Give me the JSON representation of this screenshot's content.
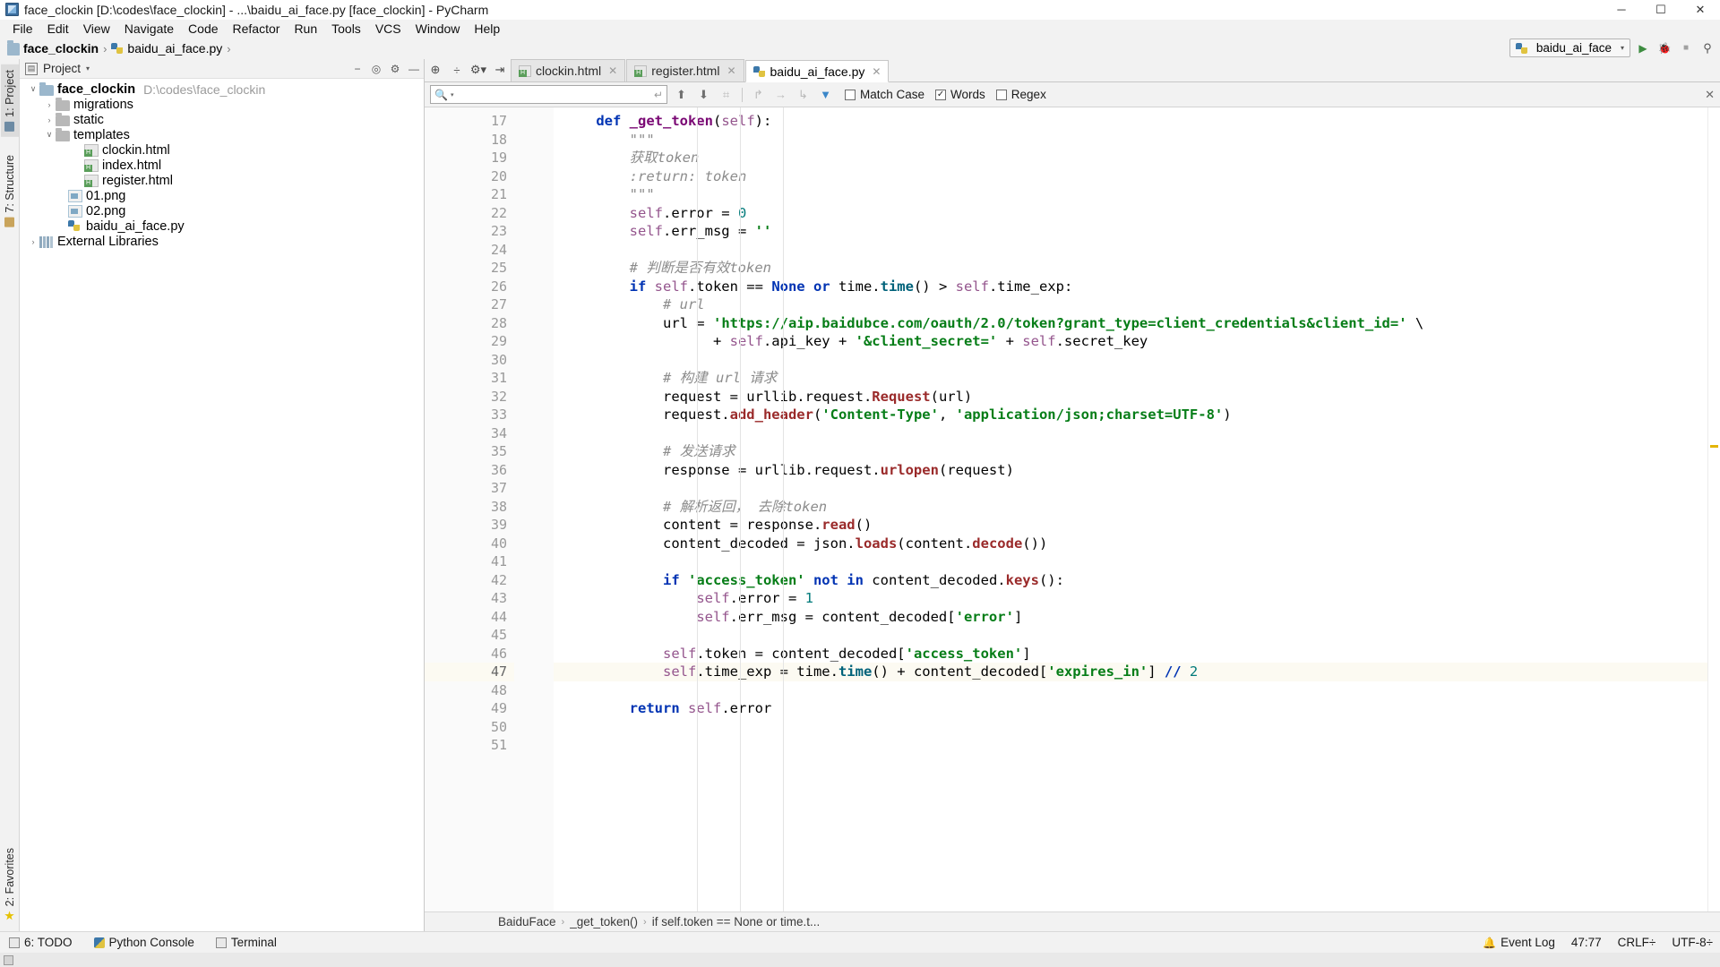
{
  "window": {
    "title": "face_clockin [D:\\codes\\face_clockin] - ...\\baidu_ai_face.py [face_clockin] - PyCharm",
    "minimize": "─",
    "maximize": "☐",
    "close": "✕"
  },
  "menu": {
    "items": [
      "File",
      "Edit",
      "View",
      "Navigate",
      "Code",
      "Refactor",
      "Run",
      "Tools",
      "VCS",
      "Window",
      "Help"
    ]
  },
  "breadcrumb": {
    "items": [
      "face_clockin",
      "baidu_ai_face.py"
    ],
    "separator": "›"
  },
  "toolbar_right": {
    "run_config": "baidu_ai_face",
    "caret": "▾",
    "run": "▶",
    "debug": "🐞",
    "stop": "■",
    "search_everywhere": "⚲"
  },
  "left_strip": {
    "tabs": [
      "1: Project",
      "7: Structure"
    ],
    "bottom_tabs": [
      "2: Favorites"
    ]
  },
  "project_panel": {
    "title": "Project",
    "caret": "▾",
    "header_icons": [
      "collapse-all-icon",
      "target-icon",
      "gear-icon",
      "hide-icon"
    ],
    "tree": [
      {
        "indent": 0,
        "arrow": "∨",
        "icon": "folder-module",
        "label": "face_clockin",
        "bold": true,
        "path": "D:\\codes\\face_clockin"
      },
      {
        "indent": 1,
        "arrow": "›",
        "icon": "folder",
        "label": "migrations",
        "bold": false,
        "path": ""
      },
      {
        "indent": 1,
        "arrow": "›",
        "icon": "folder",
        "label": "static",
        "bold": false,
        "path": ""
      },
      {
        "indent": 1,
        "arrow": "∨",
        "icon": "folder",
        "label": "templates",
        "bold": false,
        "path": ""
      },
      {
        "indent": 2,
        "arrow": "",
        "icon": "html",
        "label": "clockin.html",
        "bold": false,
        "path": ""
      },
      {
        "indent": 2,
        "arrow": "",
        "icon": "html",
        "label": "index.html",
        "bold": false,
        "path": ""
      },
      {
        "indent": 2,
        "arrow": "",
        "icon": "html",
        "label": "register.html",
        "bold": false,
        "path": ""
      },
      {
        "indent": 1,
        "arrow": "",
        "icon": "png",
        "label": "01.png",
        "bold": false,
        "path": ""
      },
      {
        "indent": 1,
        "arrow": "",
        "icon": "png",
        "label": "02.png",
        "bold": false,
        "path": ""
      },
      {
        "indent": 1,
        "arrow": "",
        "icon": "py",
        "label": "baidu_ai_face.py",
        "bold": false,
        "path": ""
      },
      {
        "indent": 0,
        "arrow": "›",
        "icon": "lib",
        "label": "External Libraries",
        "bold": false,
        "path": ""
      }
    ]
  },
  "editor": {
    "tab_tools": [
      "⊕",
      "÷",
      "⚙▾",
      "⇥"
    ],
    "tabs": [
      {
        "label": "clockin.html",
        "icon": "html-file-icon",
        "active": false,
        "close": "✕"
      },
      {
        "label": "register.html",
        "icon": "html-file-icon",
        "active": false,
        "close": "✕"
      },
      {
        "label": "baidu_ai_face.py",
        "icon": "python-file-icon",
        "active": true,
        "close": "✕"
      }
    ],
    "find_bar": {
      "search_value": "",
      "search_placeholder": "",
      "search_icon": "🔍",
      "dropdown_caret": "▾",
      "enter_hint": "↵",
      "buttons": [
        "⬆",
        "⬇",
        "⌗",
        "↱",
        "→",
        "↳",
        "filter-icon"
      ],
      "checkboxes": [
        {
          "label": "Match Case",
          "checked": false
        },
        {
          "label": "Words",
          "checked": true
        },
        {
          "label": "Regex",
          "checked": false
        }
      ],
      "close": "✕"
    },
    "first_line_number": 17,
    "current_line": 47,
    "lines": [
      {
        "n": 17,
        "fold": "−",
        "bulb": false,
        "tokens": [
          {
            "t": "    ",
            "c": "pl"
          },
          {
            "t": "def ",
            "c": "kw"
          },
          {
            "t": "_get_token",
            "c": "fnd"
          },
          {
            "t": "(",
            "c": "brk"
          },
          {
            "t": "self",
            "c": "selfk"
          },
          {
            "t": "):",
            "c": "brk"
          }
        ]
      },
      {
        "n": 18,
        "fold": "−",
        "bulb": false,
        "tokens": [
          {
            "t": "        \"\"\"",
            "c": "doc"
          }
        ]
      },
      {
        "n": 19,
        "fold": "",
        "bulb": false,
        "tokens": [
          {
            "t": "        获取token",
            "c": "doc"
          }
        ]
      },
      {
        "n": 20,
        "fold": "",
        "bulb": false,
        "tokens": [
          {
            "t": "        :return: token",
            "c": "doc"
          }
        ]
      },
      {
        "n": 21,
        "fold": "−",
        "bulb": false,
        "tokens": [
          {
            "t": "        \"\"\"",
            "c": "doc"
          }
        ]
      },
      {
        "n": 22,
        "fold": "",
        "bulb": false,
        "tokens": [
          {
            "t": "        ",
            "c": "pl"
          },
          {
            "t": "self",
            "c": "selfk"
          },
          {
            "t": ".error = ",
            "c": "pl"
          },
          {
            "t": "0",
            "c": "teal"
          }
        ]
      },
      {
        "n": 23,
        "fold": "",
        "bulb": false,
        "tokens": [
          {
            "t": "        ",
            "c": "pl"
          },
          {
            "t": "self",
            "c": "selfk"
          },
          {
            "t": ".err_msg = ",
            "c": "pl"
          },
          {
            "t": "''",
            "c": "str"
          }
        ]
      },
      {
        "n": 24,
        "fold": "",
        "bulb": false,
        "tokens": []
      },
      {
        "n": 25,
        "fold": "",
        "bulb": false,
        "tokens": [
          {
            "t": "        # 判断是否有效token",
            "c": "cmt"
          }
        ]
      },
      {
        "n": 26,
        "fold": "−",
        "bulb": false,
        "tokens": [
          {
            "t": "        ",
            "c": "pl"
          },
          {
            "t": "if ",
            "c": "kw"
          },
          {
            "t": "self",
            "c": "selfk"
          },
          {
            "t": ".token == ",
            "c": "pl"
          },
          {
            "t": "None",
            "c": "kw"
          },
          {
            "t": " or ",
            "c": "kw"
          },
          {
            "t": "time.",
            "c": "pl"
          },
          {
            "t": "time",
            "c": "fn"
          },
          {
            "t": "() > ",
            "c": "pl"
          },
          {
            "t": "self",
            "c": "selfk"
          },
          {
            "t": ".time_exp:",
            "c": "pl"
          }
        ]
      },
      {
        "n": 27,
        "fold": "",
        "bulb": false,
        "tokens": [
          {
            "t": "            # url",
            "c": "cmt"
          }
        ]
      },
      {
        "n": 28,
        "fold": "",
        "bulb": false,
        "tokens": [
          {
            "t": "            url = ",
            "c": "pl"
          },
          {
            "t": "'https://aip.baidubce.com/oauth/2.0/token?grant_type=client_credentials&client_id='",
            "c": "str"
          },
          {
            "t": " \\",
            "c": "pl"
          }
        ]
      },
      {
        "n": 29,
        "fold": "",
        "bulb": false,
        "tokens": [
          {
            "t": "                  + ",
            "c": "pl"
          },
          {
            "t": "self",
            "c": "selfk"
          },
          {
            "t": ".api_key + ",
            "c": "pl"
          },
          {
            "t": "'&client_secret='",
            "c": "str"
          },
          {
            "t": " + ",
            "c": "pl"
          },
          {
            "t": "self",
            "c": "selfk"
          },
          {
            "t": ".secret_key",
            "c": "pl"
          }
        ]
      },
      {
        "n": 30,
        "fold": "",
        "bulb": false,
        "tokens": []
      },
      {
        "n": 31,
        "fold": "",
        "bulb": false,
        "tokens": [
          {
            "t": "            # 构建 url 请求",
            "c": "cmt"
          }
        ]
      },
      {
        "n": 32,
        "fold": "",
        "bulb": false,
        "tokens": [
          {
            "t": "            request = urllib.request.",
            "c": "pl"
          },
          {
            "t": "Request",
            "c": "red"
          },
          {
            "t": "(url)",
            "c": "pl"
          }
        ]
      },
      {
        "n": 33,
        "fold": "",
        "bulb": false,
        "tokens": [
          {
            "t": "            request.",
            "c": "pl"
          },
          {
            "t": "add_header",
            "c": "red"
          },
          {
            "t": "(",
            "c": "pl"
          },
          {
            "t": "'Content-Type'",
            "c": "str"
          },
          {
            "t": ", ",
            "c": "pl"
          },
          {
            "t": "'application/json;charset=UTF-8'",
            "c": "str"
          },
          {
            "t": ")",
            "c": "pl"
          }
        ]
      },
      {
        "n": 34,
        "fold": "",
        "bulb": false,
        "tokens": []
      },
      {
        "n": 35,
        "fold": "",
        "bulb": false,
        "tokens": [
          {
            "t": "            # 发送请求",
            "c": "cmt"
          }
        ]
      },
      {
        "n": 36,
        "fold": "",
        "bulb": false,
        "tokens": [
          {
            "t": "            response = urllib.request.",
            "c": "pl"
          },
          {
            "t": "urlopen",
            "c": "red"
          },
          {
            "t": "(request)",
            "c": "pl"
          }
        ]
      },
      {
        "n": 37,
        "fold": "",
        "bulb": false,
        "tokens": []
      },
      {
        "n": 38,
        "fold": "",
        "bulb": false,
        "tokens": [
          {
            "t": "            # 解析返回， 去除token",
            "c": "cmt"
          }
        ]
      },
      {
        "n": 39,
        "fold": "",
        "bulb": false,
        "tokens": [
          {
            "t": "            content = response.",
            "c": "pl"
          },
          {
            "t": "read",
            "c": "red"
          },
          {
            "t": "()",
            "c": "pl"
          }
        ]
      },
      {
        "n": 40,
        "fold": "",
        "bulb": false,
        "tokens": [
          {
            "t": "            content_decoded = json.",
            "c": "pl"
          },
          {
            "t": "loads",
            "c": "red"
          },
          {
            "t": "(content.",
            "c": "pl"
          },
          {
            "t": "decode",
            "c": "red"
          },
          {
            "t": "())",
            "c": "pl"
          }
        ]
      },
      {
        "n": 41,
        "fold": "",
        "bulb": false,
        "tokens": []
      },
      {
        "n": 42,
        "fold": "−",
        "bulb": false,
        "tokens": [
          {
            "t": "            ",
            "c": "pl"
          },
          {
            "t": "if ",
            "c": "kw"
          },
          {
            "t": "'access_token'",
            "c": "str"
          },
          {
            "t": " not in ",
            "c": "kw"
          },
          {
            "t": "content_decoded.",
            "c": "pl"
          },
          {
            "t": "keys",
            "c": "red"
          },
          {
            "t": "():",
            "c": "pl"
          }
        ]
      },
      {
        "n": 43,
        "fold": "",
        "bulb": false,
        "tokens": [
          {
            "t": "                ",
            "c": "pl"
          },
          {
            "t": "self",
            "c": "selfk"
          },
          {
            "t": ".error = ",
            "c": "pl"
          },
          {
            "t": "1",
            "c": "teal"
          }
        ]
      },
      {
        "n": 44,
        "fold": "−",
        "bulb": false,
        "tokens": [
          {
            "t": "                ",
            "c": "pl"
          },
          {
            "t": "self",
            "c": "selfk"
          },
          {
            "t": ".err_msg = content_decoded[",
            "c": "pl"
          },
          {
            "t": "'error'",
            "c": "str"
          },
          {
            "t": "]",
            "c": "pl"
          }
        ]
      },
      {
        "n": 45,
        "fold": "",
        "bulb": false,
        "tokens": []
      },
      {
        "n": 46,
        "fold": "",
        "bulb": false,
        "tokens": [
          {
            "t": "            ",
            "c": "pl"
          },
          {
            "t": "self",
            "c": "selfk"
          },
          {
            "t": ".token = content_decoded[",
            "c": "pl"
          },
          {
            "t": "'access_token'",
            "c": "str"
          },
          {
            "t": "]",
            "c": "pl"
          }
        ]
      },
      {
        "n": 47,
        "fold": "",
        "bulb": true,
        "tokens": [
          {
            "t": "            ",
            "c": "pl"
          },
          {
            "t": "self",
            "c": "selfk"
          },
          {
            "t": ".time_exp = time.",
            "c": "pl"
          },
          {
            "t": "time",
            "c": "fn"
          },
          {
            "t": "() + content_decoded[",
            "c": "pl"
          },
          {
            "t": "'expires_in'",
            "c": "str"
          },
          {
            "t": "] ",
            "c": "pl"
          },
          {
            "t": "//",
            "c": "kw"
          },
          {
            "t": " ",
            "c": "pl"
          },
          {
            "t": "2",
            "c": "teal"
          }
        ]
      },
      {
        "n": 48,
        "fold": "",
        "bulb": false,
        "tokens": []
      },
      {
        "n": 49,
        "fold": "−",
        "bulb": false,
        "tokens": [
          {
            "t": "        ",
            "c": "pl"
          },
          {
            "t": "return ",
            "c": "kw"
          },
          {
            "t": "self",
            "c": "selfk"
          },
          {
            "t": ".error",
            "c": "pl"
          }
        ]
      },
      {
        "n": 50,
        "fold": "",
        "bulb": false,
        "tokens": []
      },
      {
        "n": 51,
        "fold": "",
        "bulb": false,
        "tokens": []
      }
    ],
    "editor_breadcrumb": {
      "items": [
        "BaiduFace",
        "_get_token()",
        "if self.token == None or time.t..."
      ],
      "separator": "›"
    }
  },
  "status_bar": {
    "left_buttons": [
      {
        "label": "6: TODO",
        "icon": "todo-icon"
      },
      {
        "label": "Python Console",
        "icon": "python-icon"
      },
      {
        "label": "Terminal",
        "icon": "terminal-icon"
      }
    ],
    "right": {
      "caret_position": "47:77",
      "line_separator": "CRLF÷",
      "encoding": "UTF-8÷",
      "event_log": "Event Log",
      "event_log_icon": "bell-icon"
    }
  }
}
